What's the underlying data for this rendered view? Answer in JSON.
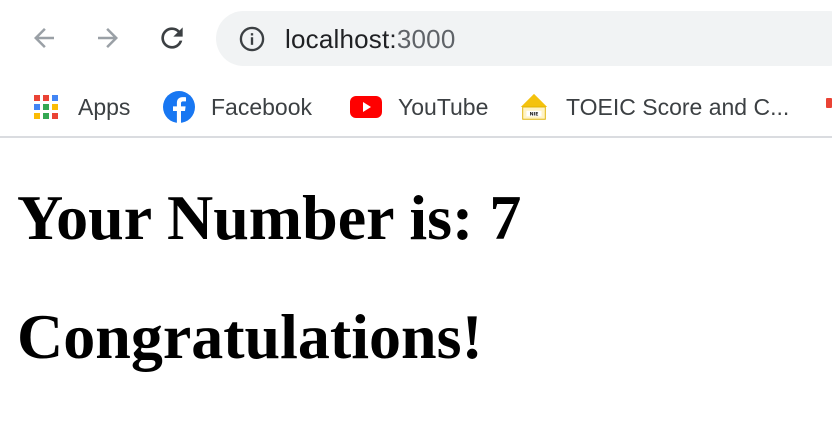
{
  "browser": {
    "address_bar": {
      "host": "localhost:",
      "port": "3000"
    },
    "bookmarks": [
      {
        "label": "Apps",
        "icon": "apps-grid-icon"
      },
      {
        "label": "Facebook",
        "icon": "facebook-icon"
      },
      {
        "label": "YouTube",
        "icon": "youtube-icon"
      },
      {
        "label": "TOEIC Score and C...",
        "icon": "toeic-icon"
      }
    ]
  },
  "page": {
    "heading_number": "Your Number is: 7",
    "heading_message": "Congratulations!"
  },
  "colors": {
    "omnibox_bg": "#f1f3f4",
    "nav_icon_disabled": "#9aa0a6",
    "nav_icon": "#5f6368",
    "youtube_red": "#ff0000",
    "facebook_blue": "#1877f2"
  }
}
